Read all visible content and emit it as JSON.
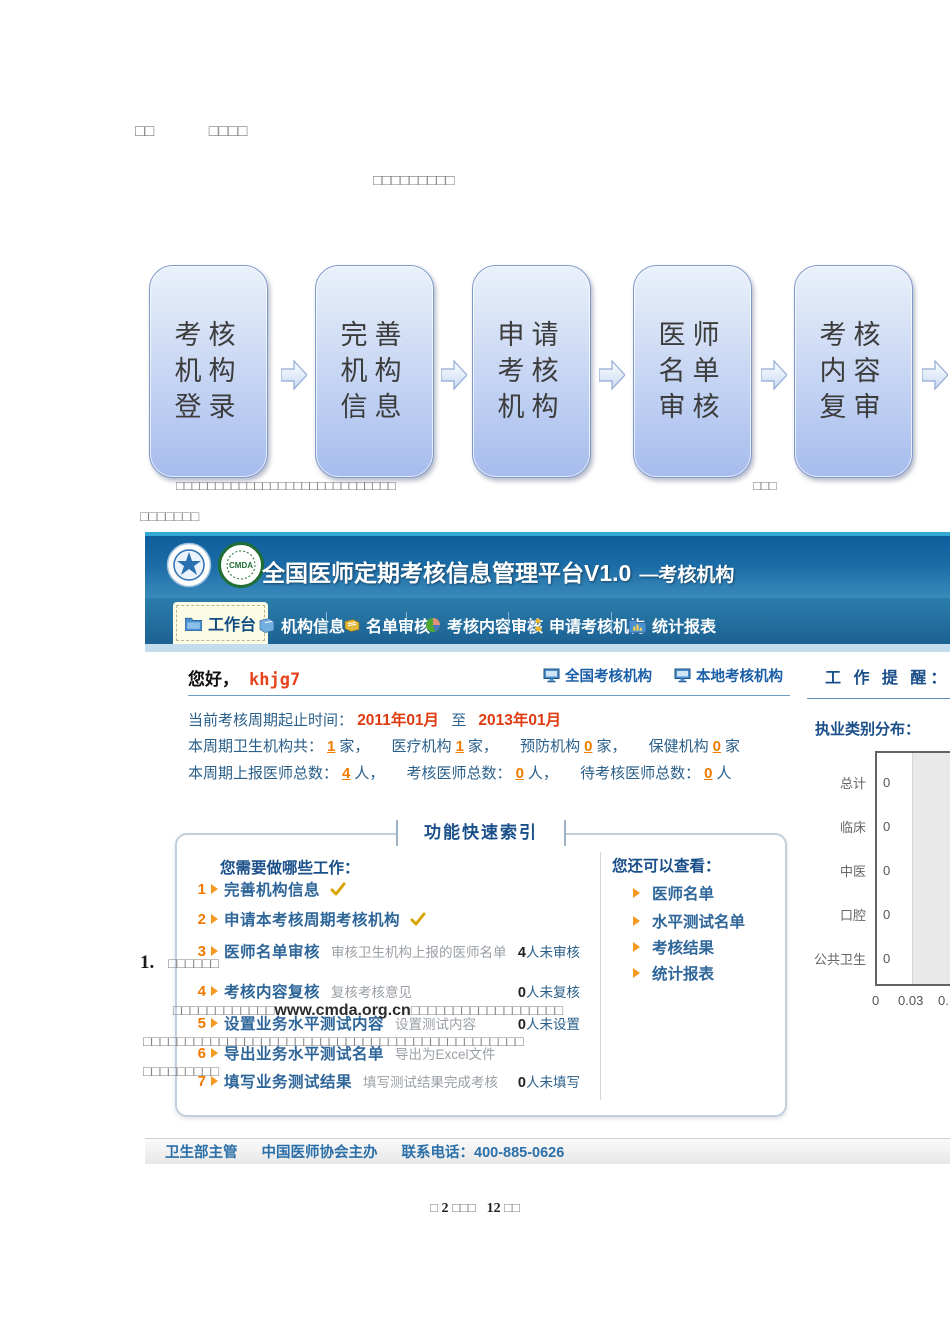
{
  "doc": {
    "header_left": "□□",
    "header_right": "□□□□",
    "title": "□□□□□□□□□",
    "caption_boxes": "□□□□□□□□□□□□□□□□□□□□□□□□□□□□",
    "caption_tail": "□□□",
    "para_boxes": "□□□□□□□",
    "list_number": "1.",
    "list_boxes": "□□□□□□",
    "overlap1_pre": "□□□□□□□□□□□□",
    "overlap1_url": "www.cmda.org.cn",
    "overlap1_post": "□□□□□□□□□□□□□□□□□□",
    "overlap2": "□□□□□□□□□□□□□□□□□□□□□□□□□□□□□□□□□□□□□□□□□□□□□",
    "overlap3": "□□□□□□□□□",
    "pagefooter": {
      "pre": "□",
      "page": "2",
      "mid": "□□□",
      "total": "12",
      "post": "□□"
    }
  },
  "flowchart": {
    "steps": [
      "考核\n机构\n登录",
      "完善\n机构\n信息",
      "申请\n考核\n机构",
      "医师\n名单\n审核",
      "考核\n内容\n复审"
    ]
  },
  "platform": {
    "title": "全国医师定期考核信息管理平台V1.0",
    "title_suffix": "—考核机构",
    "logo_cmda_text": "CMDA",
    "tabs": [
      "工作台",
      "机构信息",
      "名单审核",
      "考核内容审核",
      "申请考核机构",
      "统计报表"
    ],
    "greeting": {
      "hello": "您好，",
      "username": "khjg7"
    },
    "header_links": [
      "全国考核机构",
      "本地考核机构"
    ],
    "period": {
      "label": "当前考核周期起止时间：",
      "start": "2011年01月",
      "to": "至",
      "end": "2013年01月"
    },
    "org_row": {
      "label": "本周期卫生机构共：",
      "n1": "1",
      "u1": "家，",
      "l2": "医疗机构",
      "n2": "1",
      "u2": "家，",
      "l3": "预防机构",
      "n3": "0",
      "u3": "家，",
      "l4": "保健机构",
      "n4": "0",
      "u4": "家"
    },
    "doctor_row": {
      "label": "本周期上报医师总数：",
      "n1": "4",
      "u1": "人，",
      "l2": "考核医师总数：",
      "n2": "0",
      "u2": "人，",
      "l3": "待考核医师总数：",
      "n3": "0",
      "u3": "人"
    },
    "quick": {
      "title": "功能快速索引",
      "left_header": "您需要做哪些工作：",
      "items": [
        {
          "num": "1",
          "label": "完善机构信息",
          "check": true
        },
        {
          "num": "2",
          "label": "申请本考核周期考核机构",
          "check": true
        },
        {
          "num": "3",
          "label": "医师名单审核",
          "desc": "审核卫生机构上报的医师名单",
          "count": "4",
          "count_suffix": "人未审核"
        },
        {
          "num": "4",
          "label": "考核内容复核",
          "desc": "复核考核意见",
          "count": "0",
          "count_suffix": "人未复核"
        },
        {
          "num": "5",
          "label": "设置业务水平测试内容",
          "desc": "设置测试内容",
          "count": "0",
          "count_suffix": "人未设置"
        },
        {
          "num": "6",
          "label": "导出业务水平测试名单",
          "desc": "导出为Excel文件",
          "count": "",
          "count_suffix": ""
        },
        {
          "num": "7",
          "label": "填写业务测试结果",
          "desc": "填写测试结果完成考核",
          "count": "0",
          "count_suffix": "人未填写"
        }
      ],
      "right_header": "您还可以查看：",
      "links": [
        "医师名单",
        "水平测试名单",
        "考核结果",
        "统计报表"
      ]
    },
    "sidebar": {
      "reminder": "工 作 提 醒：",
      "dist_title": "执业类别分布："
    },
    "footer": {
      "org1": "卫生部主管",
      "org2": "中国医师协会主办",
      "phone": "联系电话：400-885-0626"
    }
  },
  "chart_data": {
    "type": "bar",
    "orientation": "horizontal",
    "title": "执业类别分布",
    "categories": [
      "总计",
      "临床",
      "中医",
      "口腔",
      "公共卫生"
    ],
    "values": [
      0,
      0,
      0,
      0,
      0
    ],
    "xticks": [
      "0",
      "0.03",
      "0."
    ],
    "xlim": [
      0,
      0.06
    ],
    "legend": false,
    "note": "all bars zero-length; value labels shown at axis"
  },
  "colors": {
    "accent_cyan": "#31a9d2",
    "header_blue": "#1a6ba6",
    "link_blue": "#1a5fa8",
    "label_blue": "#2e6699",
    "orange": "#ef7c00",
    "red": "#e03a10",
    "username_red": "#e8431c",
    "active_tab": "#fcfbe6"
  }
}
